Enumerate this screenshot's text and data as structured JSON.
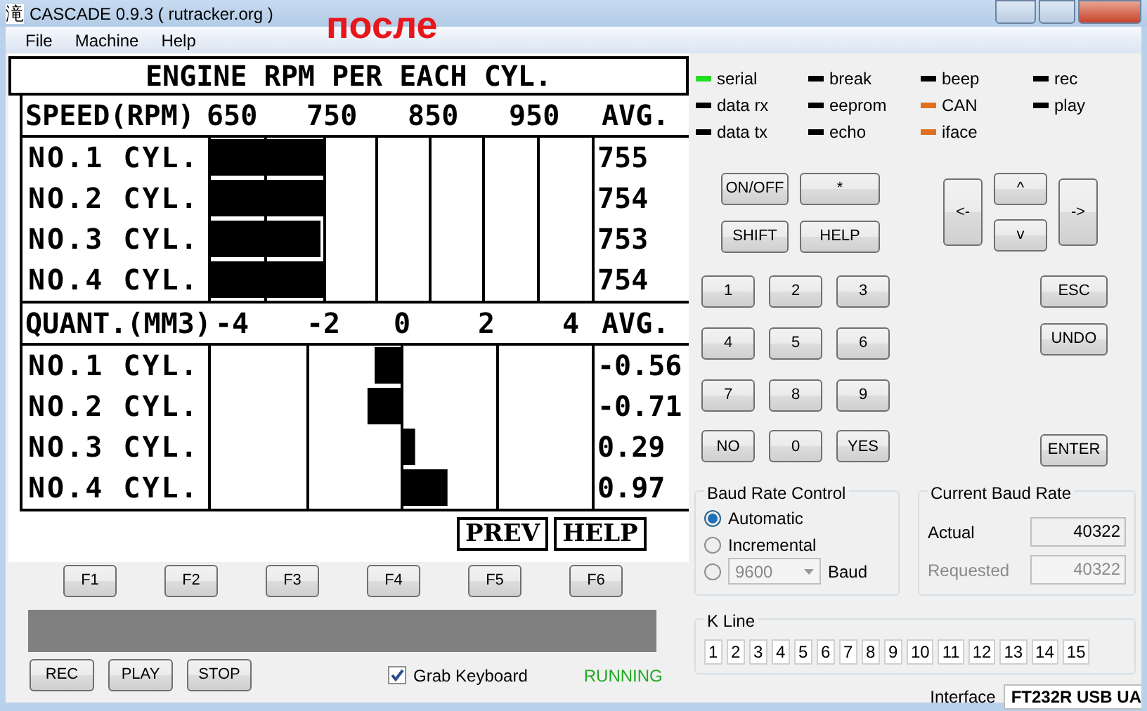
{
  "window": {
    "icon_glyph": "滝",
    "title": "CASCADE 0.9.3 ( rutracker.org )"
  },
  "annotation": "после",
  "menu": [
    "File",
    "Machine",
    "Help"
  ],
  "display": {
    "title": "ENGINE RPM PER EACH CYL.",
    "rpm": {
      "label": "SPEED(RPM)",
      "ticks": [
        "650",
        "750",
        "850",
        "950"
      ],
      "avg_label": "AVG.",
      "rows": [
        {
          "label": "NO.1 CYL.",
          "level": 0.3,
          "avg": "755"
        },
        {
          "label": "NO.2 CYL.",
          "level": 0.295,
          "avg": "754"
        },
        {
          "label": "NO.3 CYL.",
          "level": 0.288,
          "avg": "753"
        },
        {
          "label": "NO.4 CYL.",
          "level": 0.295,
          "avg": "754"
        }
      ]
    },
    "quant": {
      "label": "QUANT.(MM3)",
      "ticks": [
        "-4",
        "-2",
        "0",
        "2",
        "4"
      ],
      "avg_label": "AVG.",
      "rows": [
        {
          "label": "NO.1 CYL.",
          "avg": "-0.56"
        },
        {
          "label": "NO.2 CYL.",
          "avg": "-0.71"
        },
        {
          "label": "NO.3 CYL.",
          "avg": "0.29"
        },
        {
          "label": "NO.4 CYL.",
          "avg": "0.97"
        }
      ]
    },
    "soft_keys": [
      "PREV",
      "HELP"
    ]
  },
  "function_keys": [
    "F1",
    "F2",
    "F3",
    "F4",
    "F5",
    "F6"
  ],
  "record_buttons": [
    "REC",
    "PLAY",
    "STOP"
  ],
  "grab_keyboard": {
    "label": "Grab Keyboard",
    "checked": true
  },
  "status": "RUNNING",
  "leds": [
    {
      "label": "serial",
      "color": "#22dd22"
    },
    {
      "label": "break",
      "color": "#000000"
    },
    {
      "label": "beep",
      "color": "#000000"
    },
    {
      "label": "rec",
      "color": "#000000"
    },
    {
      "label": "data rx",
      "color": "#000000"
    },
    {
      "label": "eeprom",
      "color": "#000000"
    },
    {
      "label": "CAN",
      "color": "#e07020"
    },
    {
      "label": "play",
      "color": "#000000"
    },
    {
      "label": "data tx",
      "color": "#000000"
    },
    {
      "label": "echo",
      "color": "#000000"
    },
    {
      "label": "iface",
      "color": "#e07020"
    }
  ],
  "keys": {
    "top": [
      "ON/OFF",
      "*",
      "SHIFT",
      "HELP"
    ],
    "arrows": {
      "left": "<-",
      "up": "^",
      "down": "v",
      "right": "->"
    },
    "keypad": [
      "1",
      "2",
      "3",
      "4",
      "5",
      "6",
      "7",
      "8",
      "9",
      "NO",
      "0",
      "YES"
    ],
    "side": [
      "ESC",
      "UNDO",
      "ENTER"
    ]
  },
  "baud_control": {
    "title": "Baud Rate Control",
    "options": [
      {
        "kind": "text",
        "label": "Automatic",
        "selected": true
      },
      {
        "kind": "text",
        "label": "Incremental",
        "selected": false
      },
      {
        "kind": "select",
        "value": "9600",
        "unit": "Baud",
        "selected": false
      }
    ]
  },
  "current_baud": {
    "title": "Current Baud Rate",
    "fields": [
      {
        "label": "Actual",
        "value": "40322",
        "disabled": false
      },
      {
        "label": "Requested",
        "value": "40322",
        "disabled": true
      }
    ]
  },
  "k_line": {
    "title": "K Line",
    "lines": [
      "1",
      "2",
      "3",
      "4",
      "5",
      "6",
      "7",
      "8",
      "9",
      "10",
      "11",
      "12",
      "13",
      "14",
      "15"
    ]
  },
  "interface": {
    "label": "Interface",
    "value": "FT232R USB UA"
  }
}
